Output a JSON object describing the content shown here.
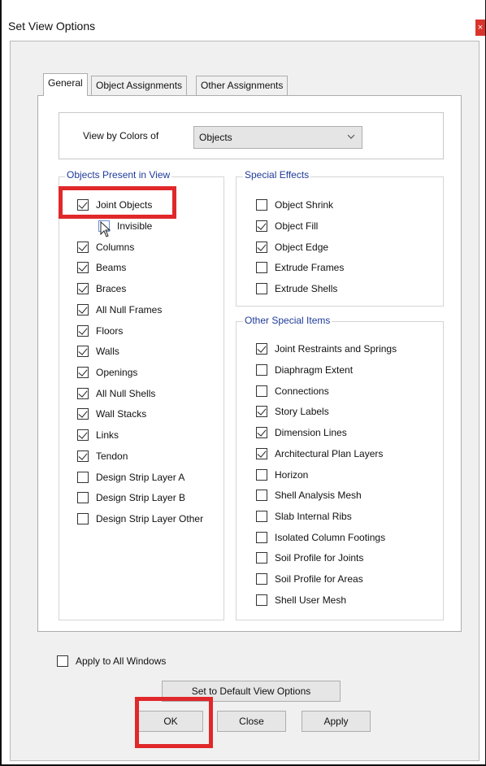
{
  "window": {
    "title": "Set View Options",
    "close_glyph": "×"
  },
  "tabs": [
    {
      "label": "General",
      "active": true
    },
    {
      "label": "Object Assignments",
      "active": false
    },
    {
      "label": "Other Assignments",
      "active": false
    }
  ],
  "view_by": {
    "label": "View by Colors of",
    "value": "Objects"
  },
  "objects_present": {
    "title": "Objects Present in View",
    "items": [
      {
        "label": "Joint Objects",
        "checked": true
      },
      {
        "label": "Invisible",
        "checked": false
      },
      {
        "label": "Columns",
        "checked": true
      },
      {
        "label": "Beams",
        "checked": true
      },
      {
        "label": "Braces",
        "checked": true
      },
      {
        "label": "All Null Frames",
        "checked": true
      },
      {
        "label": "Floors",
        "checked": true
      },
      {
        "label": "Walls",
        "checked": true
      },
      {
        "label": "Openings",
        "checked": true
      },
      {
        "label": "All Null Shells",
        "checked": true
      },
      {
        "label": "Wall Stacks",
        "checked": true
      },
      {
        "label": "Links",
        "checked": true
      },
      {
        "label": "Tendon",
        "checked": true
      },
      {
        "label": "Design Strip Layer A",
        "checked": false
      },
      {
        "label": "Design Strip Layer B",
        "checked": false
      },
      {
        "label": "Design Strip Layer Other",
        "checked": false
      }
    ]
  },
  "special_effects": {
    "title": "Special Effects",
    "items": [
      {
        "label": "Object Shrink",
        "checked": false
      },
      {
        "label": "Object Fill",
        "checked": true
      },
      {
        "label": "Object Edge",
        "checked": true
      },
      {
        "label": "Extrude Frames",
        "checked": false
      },
      {
        "label": "Extrude Shells",
        "checked": false
      }
    ]
  },
  "other_special": {
    "title": "Other Special Items",
    "items": [
      {
        "label": "Joint Restraints and Springs",
        "checked": true
      },
      {
        "label": "Diaphragm Extent",
        "checked": false
      },
      {
        "label": "Connections",
        "checked": false
      },
      {
        "label": "Story Labels",
        "checked": true
      },
      {
        "label": "Dimension Lines",
        "checked": true
      },
      {
        "label": "Architectural Plan Layers",
        "checked": true
      },
      {
        "label": "Horizon",
        "checked": false
      },
      {
        "label": "Shell Analysis Mesh",
        "checked": false
      },
      {
        "label": "Slab Internal Ribs",
        "checked": false
      },
      {
        "label": "Isolated Column Footings",
        "checked": false
      },
      {
        "label": "Soil Profile for Joints",
        "checked": false
      },
      {
        "label": "Soil Profile for Areas",
        "checked": false
      },
      {
        "label": "Shell User Mesh",
        "checked": false
      }
    ]
  },
  "apply_all": {
    "label": "Apply to All Windows",
    "checked": false
  },
  "buttons": {
    "default_label": "Set to Default View Options",
    "ok_label": "OK",
    "close_label": "Close",
    "apply_label": "Apply"
  },
  "colors": {
    "highlight": "#e0282a",
    "group_title": "#1f3b99",
    "close_button": "#d9342b"
  }
}
